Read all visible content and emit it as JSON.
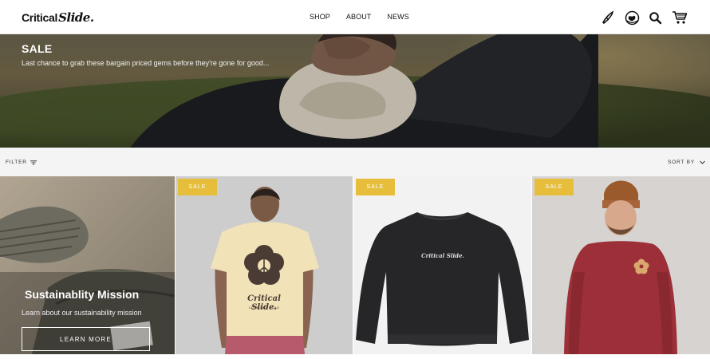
{
  "header": {
    "logo_part1": "Critical",
    "logo_part2": "Slide.",
    "nav": [
      "SHOP",
      "ABOUT",
      "NEWS"
    ],
    "icons": [
      "surfboard-icon",
      "globe-icon",
      "search-icon",
      "cart-icon"
    ]
  },
  "hero": {
    "title": "SALE",
    "subtitle": "Last chance to grab these bargain priced gems before they're gone for good..."
  },
  "toolbar": {
    "filter_label": "FILTER",
    "sort_label": "SORT BY"
  },
  "promo": {
    "title": "Sustainablity Mission",
    "subtitle": "Learn about our sustainability mission",
    "button_label": "LEARN MORE"
  },
  "products": [
    {
      "badge": "SALE",
      "print": "Critical Slide.",
      "print_sub": "141 BONDI ROAD"
    },
    {
      "badge": "SALE",
      "print": "Critical Slide."
    },
    {
      "badge": "SALE"
    }
  ],
  "colors": {
    "sale_badge": "#e6be3b",
    "header_bg": "#ffffff",
    "filterbar_bg": "#f4f4f4"
  }
}
